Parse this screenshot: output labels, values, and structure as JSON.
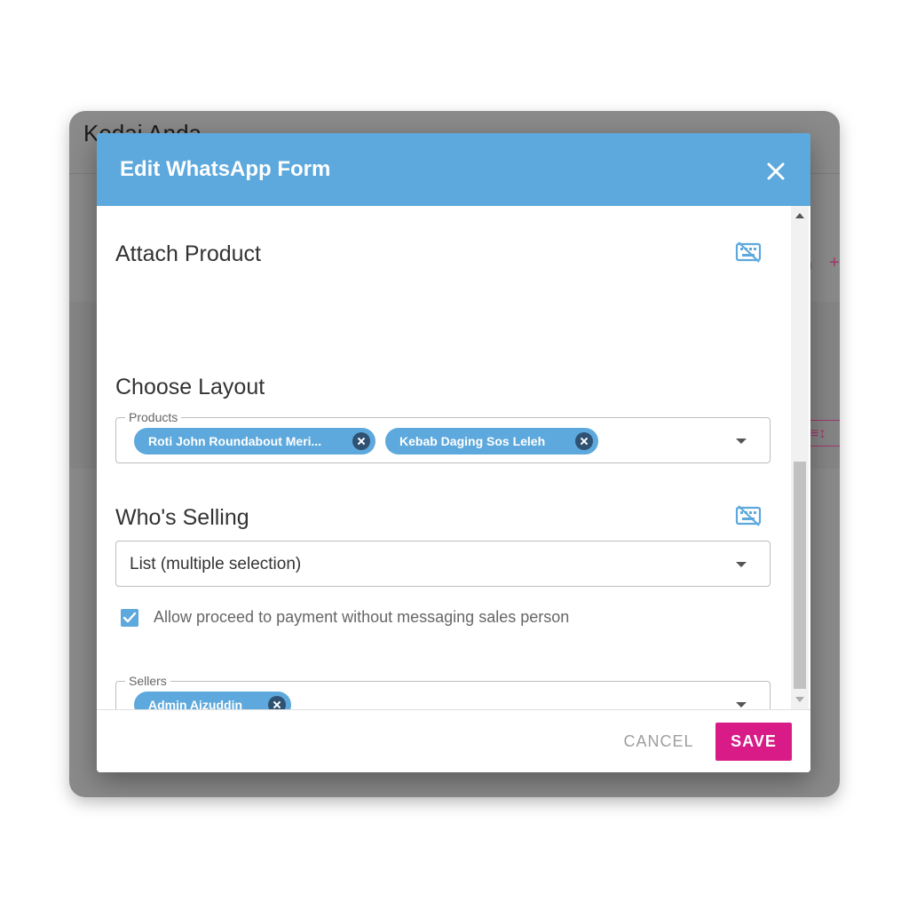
{
  "background": {
    "title": "Kedai Anda"
  },
  "dialog": {
    "title": "Edit WhatsApp Form",
    "close_icon": "close-icon",
    "header_color": "#5da8dc"
  },
  "attach_product": {
    "heading": "Attach Product",
    "toggle_icon": "keyboard-off-icon",
    "field_label": "Products",
    "chips": [
      {
        "label": "Roti John Roundabout Meri..."
      },
      {
        "label": "Kebab Daging Sos Leleh"
      }
    ]
  },
  "choose_layout": {
    "heading": "Choose Layout",
    "selected": "List (multiple selection)"
  },
  "whos_selling": {
    "heading": "Who's Selling",
    "toggle_icon": "keyboard-off-icon",
    "field_label": "Sellers",
    "chips": [
      {
        "label": "Admin Aizuddin"
      }
    ]
  },
  "payment_option": {
    "checked": true,
    "label": "Allow proceed to payment without messaging sales person"
  },
  "footer": {
    "cancel_label": "CANCEL",
    "save_label": "SAVE",
    "save_color": "#d81b87"
  }
}
